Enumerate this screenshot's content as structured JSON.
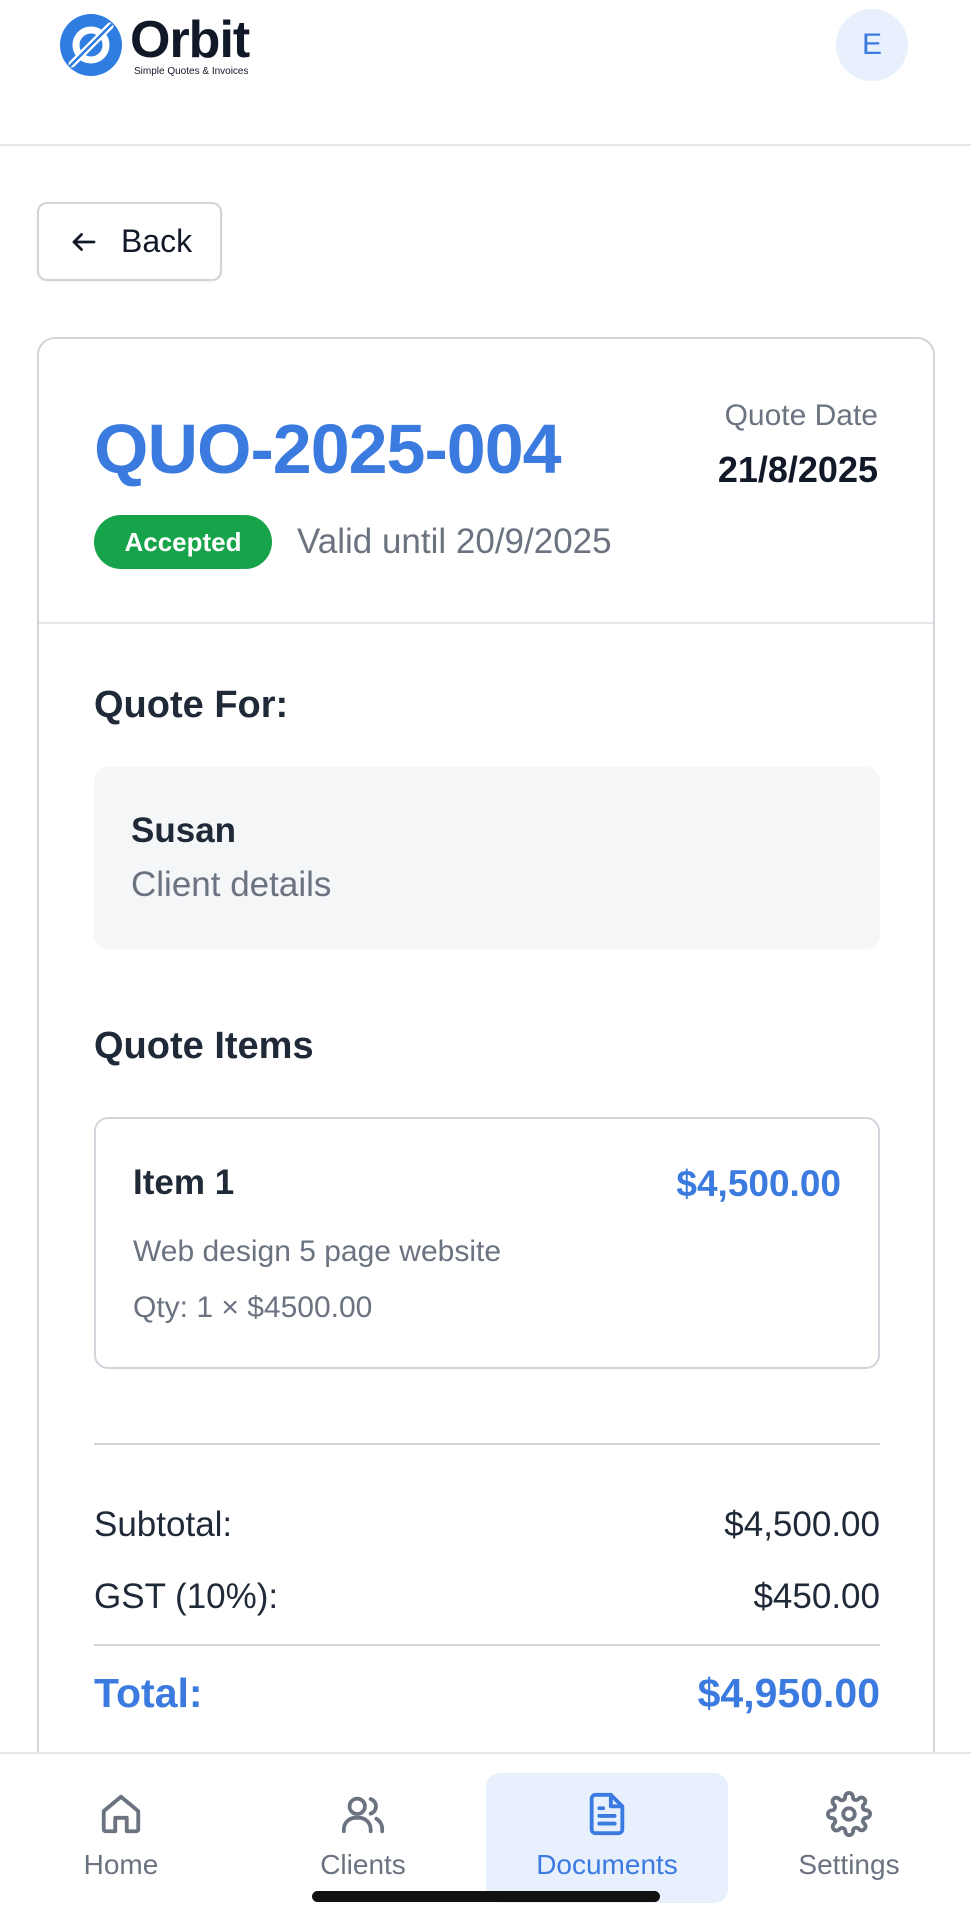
{
  "header": {
    "logo_word": "Orbit",
    "logo_tagline": "Simple Quotes & Invoices",
    "avatar_initial": "E"
  },
  "back_button": {
    "label": "Back"
  },
  "quote": {
    "number": "QUO-2025-004",
    "date_label": "Quote Date",
    "date_value": "21/8/2025",
    "status": "Accepted",
    "valid_until": "Valid until 20/9/2025"
  },
  "client_section": {
    "title": "Quote For:",
    "name": "Susan",
    "details": "Client details"
  },
  "items_section": {
    "title": "Quote Items",
    "items": [
      {
        "title": "Item 1",
        "amount": "$4,500.00",
        "description": "Web design 5 page website",
        "qty_line": "Qty: 1 × $4500.00"
      }
    ]
  },
  "totals": {
    "subtotal_label": "Subtotal:",
    "subtotal_value": "$4,500.00",
    "gst_label": "GST (10%):",
    "gst_value": "$450.00",
    "total_label": "Total:",
    "total_value": "$4,950.00"
  },
  "nav": {
    "items": [
      {
        "label": "Home",
        "icon": "home-icon",
        "active": false
      },
      {
        "label": "Clients",
        "icon": "users-icon",
        "active": false
      },
      {
        "label": "Documents",
        "icon": "document-icon",
        "active": true
      },
      {
        "label": "Settings",
        "icon": "gear-icon",
        "active": false
      }
    ]
  },
  "colors": {
    "accent": "#3b7be0",
    "status_accepted": "#16a34a",
    "muted_text": "#6b7280"
  }
}
